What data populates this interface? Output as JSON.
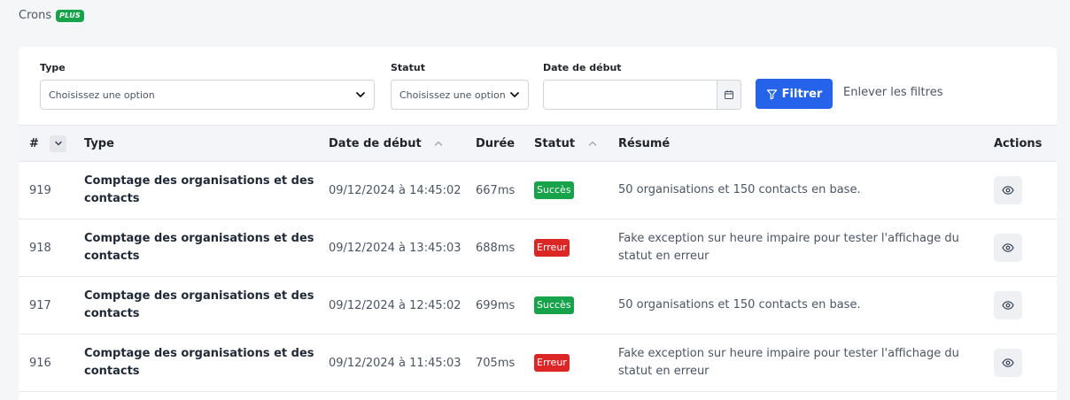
{
  "header": {
    "title": "Crons",
    "badge": "PLUS"
  },
  "filters": {
    "type_label": "Type",
    "type_value": "Choisissez une option",
    "statut_label": "Statut",
    "statut_value": "Choisissez une option",
    "date_label": "Date de début",
    "date_value": "",
    "filter_button": "Filtrer",
    "clear_link": "Enlever les filtres"
  },
  "table": {
    "headers": {
      "id": "#",
      "type": "Type",
      "date": "Date de début",
      "duration": "Durée",
      "status": "Statut",
      "summary": "Résumé",
      "actions": "Actions"
    },
    "rows": [
      {
        "id": "919",
        "type": "Comptage des organisations et des contacts",
        "date": "09/12/2024 à 14:45:02",
        "duration": "667ms",
        "status": "Succès",
        "status_kind": "success",
        "summary": "50 organisations et 150 contacts en base."
      },
      {
        "id": "918",
        "type": "Comptage des organisations et des contacts",
        "date": "09/12/2024 à 13:45:03",
        "duration": "688ms",
        "status": "Erreur",
        "status_kind": "error",
        "summary": "Fake exception sur heure impaire pour tester l'affichage du statut en erreur"
      },
      {
        "id": "917",
        "type": "Comptage des organisations et des contacts",
        "date": "09/12/2024 à 12:45:02",
        "duration": "699ms",
        "status": "Succès",
        "status_kind": "success",
        "summary": "50 organisations et 150 contacts en base."
      },
      {
        "id": "916",
        "type": "Comptage des organisations et des contacts",
        "date": "09/12/2024 à 11:45:03",
        "duration": "705ms",
        "status": "Erreur",
        "status_kind": "error",
        "summary": "Fake exception sur heure impaire pour tester l'affichage du statut en erreur"
      }
    ]
  },
  "colors": {
    "primary": "#2563eb",
    "success": "#16a34a",
    "error": "#dc2626"
  }
}
